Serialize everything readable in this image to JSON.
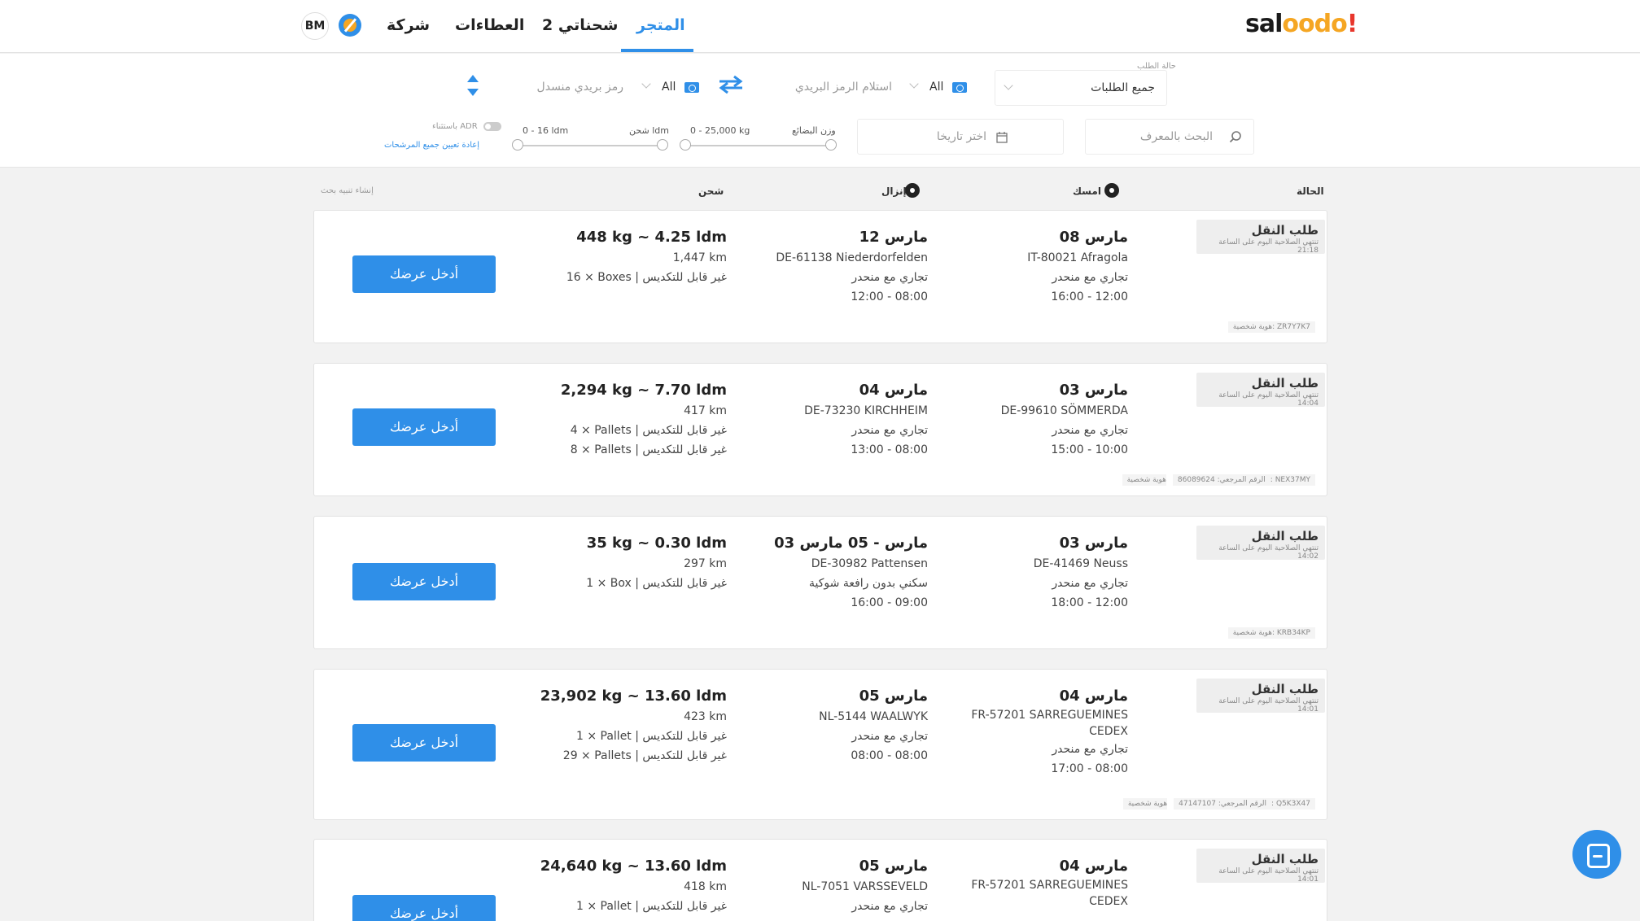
{
  "header": {
    "logo": {
      "part1": "sal",
      "part2": "oo",
      "part3": "do",
      "part4": "!"
    },
    "nav": [
      {
        "label": "المتجر",
        "active": true
      },
      {
        "label": "2 شحناتي"
      },
      {
        "label": "العطاءات"
      },
      {
        "label": "شركة"
      }
    ],
    "avatar": "BM"
  },
  "filters": {
    "status_label": "حالة الطلب",
    "status_value": "جميع الطلبات",
    "pickup_country": "All",
    "pickup_postcode_placeholder": "استلام الرمز البريدي",
    "delivery_country": "All",
    "delivery_postcode_placeholder": "رمز بريدي منسدل",
    "search_placeholder": "البحث بالمعرف",
    "date_placeholder": "اختر تاريخا",
    "weight_label": "وزن البضائع",
    "weight_range": "0 - 25,000 kg",
    "ldm_label": "شحن ldm",
    "ldm_range": "0 - 16 ldm",
    "adr_label": "باستثناء ADR",
    "reset_label": "إعادة تعيين جميع المرشحات"
  },
  "columns": {
    "status": "الحالة",
    "pickup": "امسك",
    "delivery": "إنزال",
    "freight": "شحن",
    "create_alert": "إنشاء تنبيه بحث"
  },
  "accent": "#2f8fe8",
  "cards": [
    {
      "badge": "طلب النقل",
      "badge_sub": "تنتهي الصلاحية اليوم على الساعة 21:18",
      "pickup_date": "08 مارس",
      "pickup_lines": [
        "IT-80021 Afragola",
        "تجاري مع منحدر",
        "16:00 - 12:00"
      ],
      "delivery_date": "12 مارس",
      "delivery_lines": [
        "DE-61138 Niederdorfelden",
        "تجاري مع منحدر",
        "12:00 - 08:00"
      ],
      "freight_title": "448 kg ~ 4.25 ldm",
      "freight_lines": [
        "1,447 km",
        "16 × Boxes | غير قابل للتكديس"
      ],
      "id": "هوية شخصية: ZR7Y7K7",
      "ref": "",
      "button": "أدخل عرضك"
    },
    {
      "badge": "طلب النقل",
      "badge_sub": "تنتهي الصلاحية اليوم على الساعة 14:04",
      "pickup_date": "03 مارس",
      "pickup_lines": [
        "DE-99610 SÖMMERDA",
        "تجاري مع منحدر",
        "15:00 - 10:00"
      ],
      "delivery_date": "04 مارس",
      "delivery_lines": [
        "DE-73230 KIRCHHEIM",
        "تجاري مع منحدر",
        "13:00 - 08:00"
      ],
      "freight_title": "2,294 kg ~ 7.70 ldm",
      "freight_lines": [
        "417 km",
        "4 × Pallets | غير قابل للتكديس",
        "8 × Pallets | غير قابل للتكديس"
      ],
      "id": "هوية شخصية: NEX37MY",
      "ref": "الرقم المرجعي: 86089624",
      "button": "أدخل عرضك"
    },
    {
      "badge": "طلب النقل",
      "badge_sub": "تنتهي الصلاحية اليوم على الساعة 14:02",
      "pickup_date": "03 مارس",
      "pickup_lines": [
        "DE-41469 Neuss",
        "تجاري مع منحدر",
        "18:00 - 12:00"
      ],
      "delivery_date": "03 مارس - 05 مارس",
      "delivery_lines": [
        "DE-30982 Pattensen",
        "سكني بدون رافعة شوكية",
        "16:00 - 09:00"
      ],
      "freight_title": "35 kg ~ 0.30 ldm",
      "freight_lines": [
        "297 km",
        "1 × Box | غير قابل للتكديس"
      ],
      "id": "هوية شخصية: KRB34KP",
      "ref": "",
      "button": "أدخل عرضك"
    },
    {
      "badge": "طلب النقل",
      "badge_sub": "تنتهي الصلاحية اليوم على الساعة 14:01",
      "pickup_date": "04 مارس",
      "pickup_lines": [
        "FR-57201 SARREGUEMINES",
        "CEDEX",
        "تجاري مع منحدر",
        "17:00 - 08:00"
      ],
      "delivery_date": "05 مارس",
      "delivery_lines": [
        "NL-5144 WAALWYK",
        "تجاري مع منحدر",
        "08:00 - 08:00"
      ],
      "freight_title": "23,902 kg ~ 13.60 ldm",
      "freight_lines": [
        "423 km",
        "1 × Pallet | غير قابل للتكديس",
        "29 × Pallets | غير قابل للتكديس"
      ],
      "id": "هوية شخصية: Q5K3X47",
      "ref": "الرقم المرجعي: 47147107",
      "button": "أدخل عرضك"
    },
    {
      "badge": "طلب النقل",
      "badge_sub": "تنتهي الصلاحية اليوم على الساعة 14:01",
      "pickup_date": "04 مارس",
      "pickup_lines": [
        "FR-57201 SARREGUEMINES",
        "CEDEX"
      ],
      "delivery_date": "05 مارس",
      "delivery_lines": [
        "NL-7051 VARSSEVELD",
        "تجاري مع منحدر"
      ],
      "freight_title": "24,640 kg ~ 13.60 ldm",
      "freight_lines": [
        "418 km",
        "1 × Pallet | غير قابل للتكديس"
      ],
      "id": "",
      "ref": "",
      "button": "أدخل عرضك"
    }
  ]
}
